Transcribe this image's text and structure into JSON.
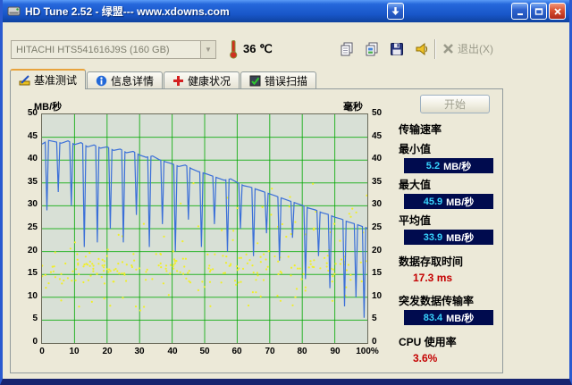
{
  "window": {
    "title": "HD Tune 2.52 - 绿盟--- www.xdowns.com"
  },
  "toolbar": {
    "device": "HITACHI HTS541616J9S (160 GB)",
    "temperature": "36",
    "temperature_unit": "℃",
    "exit_label": "退出(X)"
  },
  "tabs": [
    {
      "label": "基准测试"
    },
    {
      "label": "信息详情"
    },
    {
      "label": "健康状况"
    },
    {
      "label": "错误扫描"
    }
  ],
  "panel": {
    "start_label": "开始",
    "transfer_title": "传输速率",
    "min_label": "最小值",
    "min_value": "5.2",
    "min_unit": "MB/秒",
    "max_label": "最大值",
    "max_value": "45.9",
    "max_unit": "MB/秒",
    "avg_label": "平均值",
    "avg_value": "33.9",
    "avg_unit": "MB/秒",
    "access_label": "数据存取时间",
    "access_value": "17.3 ms",
    "burst_label": "突发数据传输率",
    "burst_value": "83.4",
    "burst_unit": "MB/秒",
    "cpu_label": "CPU 使用率",
    "cpu_value": "3.6%"
  },
  "colors": {
    "badge_bg": "#000b4e",
    "badge_value": "#37d5ff",
    "accent_red": "#c40000",
    "line": "#3a6fd8",
    "scatter": "#f0ee28",
    "grid": "#00a800",
    "plot_bg": "#d8e0d6"
  },
  "chart_data": {
    "type": "line+scatter",
    "left_axis_label": "MB/秒",
    "right_axis_label": "毫秒",
    "xlim": [
      0,
      100
    ],
    "ylim": [
      0,
      50
    ],
    "y_ticks": [
      "50",
      "45",
      "40",
      "35",
      "30",
      "25",
      "20",
      "15",
      "10",
      "5",
      "0"
    ],
    "x_ticks": [
      "0",
      "10",
      "20",
      "30",
      "40",
      "50",
      "60",
      "70",
      "80",
      "90",
      "100%"
    ],
    "series": [
      {
        "name": "transfer-rate",
        "color": "#3a6fd8",
        "base": [
          [
            0,
            43.5
          ],
          [
            2,
            44.3
          ],
          [
            4,
            44.0
          ],
          [
            6,
            43.7
          ],
          [
            8,
            44.2
          ],
          [
            10,
            43.4
          ],
          [
            12,
            43.8
          ],
          [
            14,
            42.9
          ],
          [
            16,
            43.3
          ],
          [
            18,
            42.6
          ],
          [
            20,
            42.9
          ],
          [
            22,
            42.1
          ],
          [
            24,
            42.4
          ],
          [
            26,
            41.6
          ],
          [
            28,
            41.9
          ],
          [
            30,
            41.1
          ],
          [
            32,
            40.6
          ],
          [
            34,
            40.9
          ],
          [
            36,
            40.1
          ],
          [
            38,
            39.6
          ],
          [
            40,
            39.2
          ],
          [
            42,
            38.6
          ],
          [
            44,
            38.9
          ],
          [
            46,
            38.1
          ],
          [
            48,
            37.5
          ],
          [
            50,
            37.1
          ],
          [
            52,
            36.6
          ],
          [
            54,
            36.1
          ],
          [
            56,
            35.6
          ],
          [
            58,
            35.9
          ],
          [
            60,
            35.1
          ],
          [
            62,
            34.4
          ],
          [
            64,
            34.1
          ],
          [
            66,
            33.6
          ],
          [
            68,
            33.1
          ],
          [
            70,
            32.6
          ],
          [
            72,
            32.1
          ],
          [
            74,
            31.6
          ],
          [
            76,
            31.1
          ],
          [
            78,
            30.6
          ],
          [
            80,
            30.1
          ],
          [
            82,
            29.5
          ],
          [
            84,
            29.1
          ],
          [
            86,
            28.5
          ],
          [
            88,
            28.1
          ],
          [
            90,
            27.5
          ],
          [
            92,
            27.1
          ],
          [
            94,
            26.5
          ],
          [
            96,
            26.1
          ],
          [
            98,
            25.6
          ],
          [
            100,
            25.1
          ]
        ],
        "dips": [
          [
            1.5,
            29
          ],
          [
            5,
            33
          ],
          [
            9,
            30
          ],
          [
            13,
            21
          ],
          [
            17,
            22
          ],
          [
            21,
            25
          ],
          [
            25,
            22
          ],
          [
            29,
            28
          ],
          [
            33,
            21
          ],
          [
            37,
            26
          ],
          [
            41,
            20
          ],
          [
            45,
            27
          ],
          [
            49,
            21
          ],
          [
            53,
            26
          ],
          [
            57,
            20
          ],
          [
            61,
            25
          ],
          [
            65,
            19
          ],
          [
            69,
            24
          ],
          [
            73,
            18
          ],
          [
            77,
            23
          ],
          [
            81,
            14
          ],
          [
            85,
            19
          ],
          [
            88.5,
            12
          ],
          [
            93,
            8
          ],
          [
            96.5,
            10
          ],
          [
            99,
            5.5
          ]
        ]
      },
      {
        "name": "access-time",
        "type": "scatter",
        "color": "#f0ee28",
        "seed": 7,
        "count": 270,
        "bands": [
          {
            "w": 0.52,
            "y": [
              13,
              19.5
            ]
          },
          {
            "w": 0.18,
            "y": [
              15,
              17.5
            ]
          },
          {
            "w": 0.12,
            "y": [
              19.5,
              27
            ]
          },
          {
            "w": 0.08,
            "y": [
              27,
              35
            ],
            "x": [
              40,
              100
            ]
          },
          {
            "w": 0.1,
            "y": [
              7,
              13
            ]
          }
        ]
      }
    ],
    "summary": {
      "min_mbs": 5.2,
      "max_mbs": 45.9,
      "avg_mbs": 33.9,
      "access_ms": 17.3,
      "burst_mbs": 83.4,
      "cpu_pct": 3.6
    }
  }
}
